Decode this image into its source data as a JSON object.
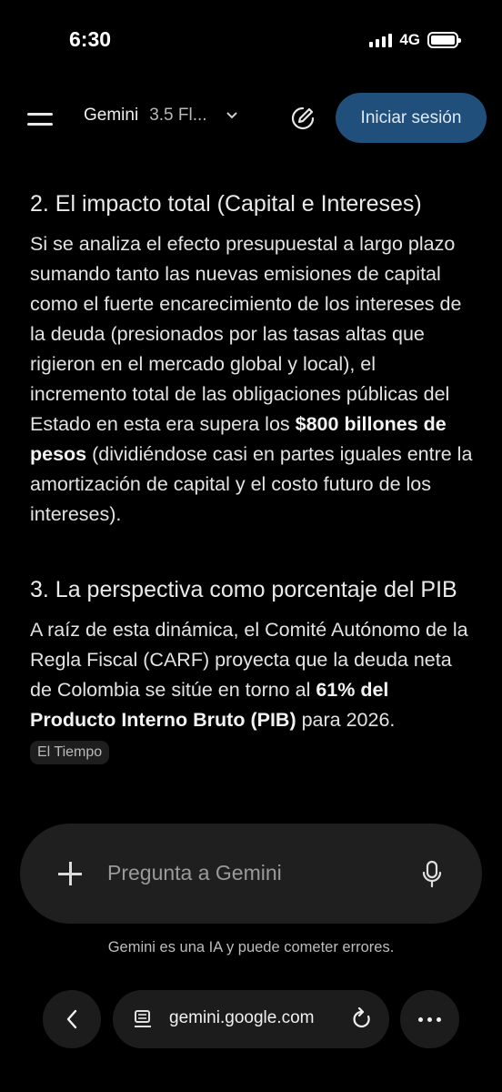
{
  "status_bar": {
    "time": "6:30",
    "network": "4G",
    "icons": [
      "signal-icon",
      "battery-icon"
    ]
  },
  "header": {
    "model_name": "Gemini",
    "model_version": "3.5 Fl...",
    "signin_label": "Iniciar sesión",
    "icons": [
      "menu-icon",
      "chevron-down-icon",
      "new-chat-icon"
    ],
    "accent_color": "#1f4f7a"
  },
  "content": {
    "section2": {
      "heading": "2. El impacto total (Capital e Intereses)",
      "text_before": "Si se analiza el efecto presupuestal a largo plazo sumando tanto las nuevas emisiones de capital como el fuerte encarecimiento de los intereses de la deuda (presionados por las tasas altas que rigieron en el mercado global y local), el incremento total de las obligaciones públicas del Estado en esta era supera los ",
      "bold": "$800 billones de pesos",
      "text_after": " (dividiéndose casi en partes iguales entre la amortización de capital y el costo futuro de los intereses)."
    },
    "section3": {
      "heading": "3. La perspectiva como porcentaje del PIB",
      "text_before": "A raíz de esta dinámica, el Comité Autónomo de la Regla Fiscal (CARF) proyecta que la deuda neta de Colombia se sitúe en torno al ",
      "bold": "61% del Producto Interno Bruto (PIB)",
      "text_after": " para 2026."
    },
    "source_label": "El Tiempo"
  },
  "input": {
    "placeholder": "Pregunta a Gemini",
    "value": "",
    "icons": [
      "plus-icon",
      "microphone-icon"
    ]
  },
  "disclaimer": "Gemini es una IA y puede cometer errores.",
  "browser": {
    "url": "gemini.google.com",
    "icons": [
      "back-arrow-icon",
      "page-icon",
      "reload-icon",
      "more-icon"
    ]
  }
}
